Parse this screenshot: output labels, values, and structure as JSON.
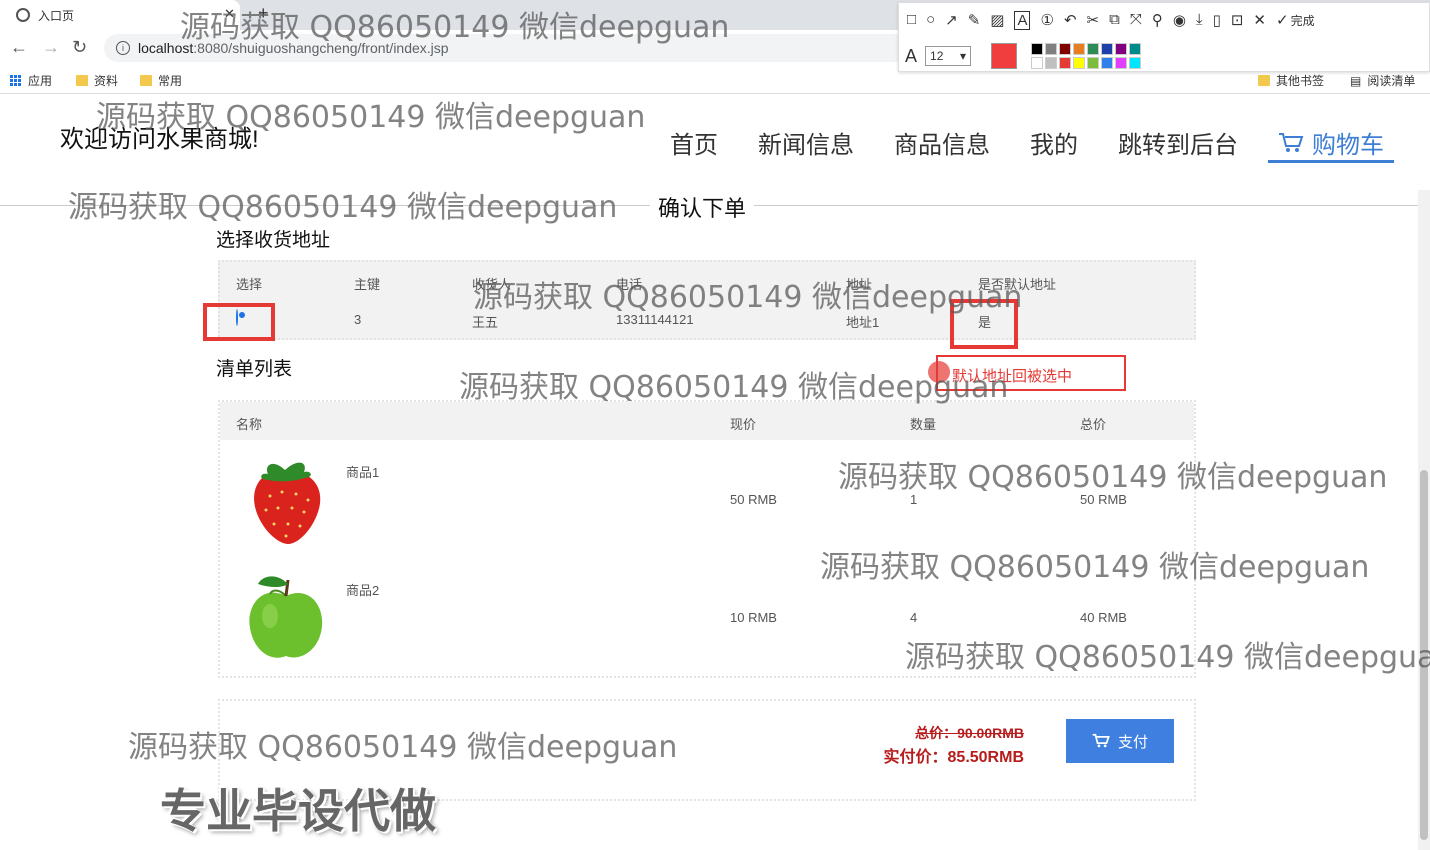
{
  "browser": {
    "tab_title": "入口页",
    "tab_close": "✕",
    "new_tab": "+",
    "back": "←",
    "forward": "→",
    "reload": "↻",
    "url_host": "localhost",
    "url_path": ":8080/shuiguoshangcheng/front/index.jsp",
    "bookmarks": [
      {
        "label": "应用",
        "icon": "apps-icon"
      },
      {
        "label": "资料",
        "icon": "folder-icon"
      },
      {
        "label": "常用",
        "icon": "folder-icon"
      }
    ],
    "other_bookmarks": "其他书签",
    "reading_list": "阅读清单"
  },
  "annotation_toolbar": {
    "font_size": "12",
    "done_label": "完成",
    "current_color": "#f03d3d",
    "palette": [
      "#000000",
      "#808080",
      "#800000",
      "#e67e22",
      "#2e8b57",
      "#1e3fa8",
      "#800080",
      "#008b8b",
      "#ffffff",
      "#c0c0c0",
      "#e53935",
      "#ffff00",
      "#7cbd3c",
      "#2f80ed",
      "#e040fb",
      "#00e5ff"
    ]
  },
  "site": {
    "welcome": "欢迎访问水果商城!",
    "nav": [
      "首页",
      "新闻信息",
      "商品信息",
      "我的",
      "跳转到后台"
    ],
    "nav_active": "购物车",
    "page_title": "确认下单"
  },
  "address": {
    "section_title": "选择收货地址",
    "headers": [
      "选择",
      "主键",
      "收货人",
      "电话",
      "地址",
      "是否默认地址"
    ],
    "rows": [
      {
        "selected": true,
        "id": "3",
        "name": "王五",
        "phone": "13311144121",
        "address": "地址1",
        "is_default": "是"
      }
    ]
  },
  "annotation_tip": "默认地址回被选中",
  "items": {
    "section_title": "清单列表",
    "headers": [
      "名称",
      "现价",
      "数量",
      "总价"
    ],
    "rows": [
      {
        "name": "商品1",
        "price": "50 RMB",
        "qty": "1",
        "total": "50 RMB",
        "image": "strawberry"
      },
      {
        "name": "商品2",
        "price": "10 RMB",
        "qty": "4",
        "total": "40 RMB",
        "image": "green-apple"
      }
    ]
  },
  "payment": {
    "original": "总价：90.00RMB",
    "actual": "实付价：85.50RMB",
    "pay_label": "支付"
  },
  "watermark": "源码获取 QQ86050149 微信deepguan",
  "promo": "专业毕设代做",
  "colors": {
    "accent": "#3e7fd6",
    "price": "#b71c1c",
    "highlight": "#e53935"
  }
}
